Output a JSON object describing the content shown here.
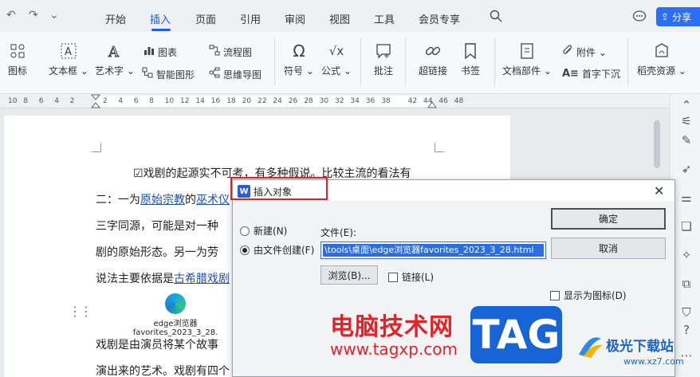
{
  "menubar": {
    "quick_icons": [
      "↶",
      "↷",
      "⌄"
    ],
    "tabs": [
      "开始",
      "插入",
      "页面",
      "引用",
      "审阅",
      "视图",
      "工具",
      "会员专享"
    ],
    "active_tab": "插入",
    "share_label": "分享"
  },
  "ribbon": {
    "picture": "图标",
    "textbox": "文本框",
    "wordart": "艺术字",
    "chart": "图表",
    "smartart": "智能图形",
    "flowchart": "流程图",
    "mindmap": "思维导图",
    "symbol": "符号",
    "formula": "公式",
    "comment": "批注",
    "hyperlink": "超链接",
    "bookmark": "书签",
    "docparts": "文档部件",
    "attachment": "附件",
    "dropcap": "首字下沉",
    "resources": "稻壳资源"
  },
  "ruler": {
    "ticks": [
      "10",
      "8",
      "6",
      "4",
      "2",
      "2",
      "4",
      "6",
      "8",
      "10",
      "12",
      "14",
      "16",
      "18",
      "20",
      "22",
      "24",
      "26",
      "28",
      "30",
      "32",
      "34",
      "36",
      "38",
      "42",
      "44",
      "46",
      "48"
    ]
  },
  "document": {
    "line1": "☑戏剧的起源实不可考，有多种假说。比较主流的看法有",
    "line2_prefix": "二：一为",
    "line2_link1": "原始宗教",
    "line2_mid": "的",
    "line2_link2": "巫术仪",
    "line3": "三字同源，可能是对一种",
    "line4": "剧的原始形态。另一为劳",
    "line5_prefix": "说法主要依据是",
    "line5_link": "古希腊戏剧",
    "object_caption": "edge浏览器favorites_2023_3_28.",
    "line6": "戏剧是由演员将某个故事",
    "line7": "演出来的艺术。戏剧有四个"
  },
  "dialog": {
    "title": "插入对象",
    "logo_letter": "W",
    "close": "✕",
    "radio_new": "新建(N)",
    "radio_from_file": "由文件创建(F)",
    "file_label": "文件(E):",
    "file_value": "\\tools\\桌面\\edge浏览器favorites_2023_3_28.html",
    "browse": "浏览(B)...",
    "link": "链接(L)",
    "show_as_icon": "显示为图标(D)",
    "ok": "确定",
    "cancel": "取消"
  },
  "watermark": {
    "site_name": "电脑技术网",
    "site_url": "www.tagxp.com",
    "tag": "TAG",
    "brand": "极光下载站",
    "brand_url": "www.xz7.com"
  }
}
